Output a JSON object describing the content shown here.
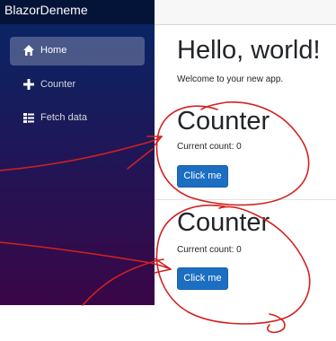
{
  "sidebar": {
    "brand": "BlazorDeneme",
    "items": [
      {
        "label": "Home",
        "icon": "home-icon",
        "active": true
      },
      {
        "label": "Counter",
        "icon": "plus-icon",
        "active": false
      },
      {
        "label": "Fetch data",
        "icon": "list-icon",
        "active": false
      }
    ]
  },
  "index": {
    "title": "Hello, world!",
    "welcome": "Welcome to your new app."
  },
  "counters": [
    {
      "title": "Counter",
      "count_text": "Current count: 0",
      "button_label": "Click me"
    },
    {
      "title": "Counter",
      "count_text": "Current count: 0",
      "button_label": "Click me"
    }
  ],
  "colors": {
    "button": "#1b6ec2",
    "sidebar_top": "#052767",
    "sidebar_bottom": "#3a0647",
    "annotation": "#d42020"
  }
}
